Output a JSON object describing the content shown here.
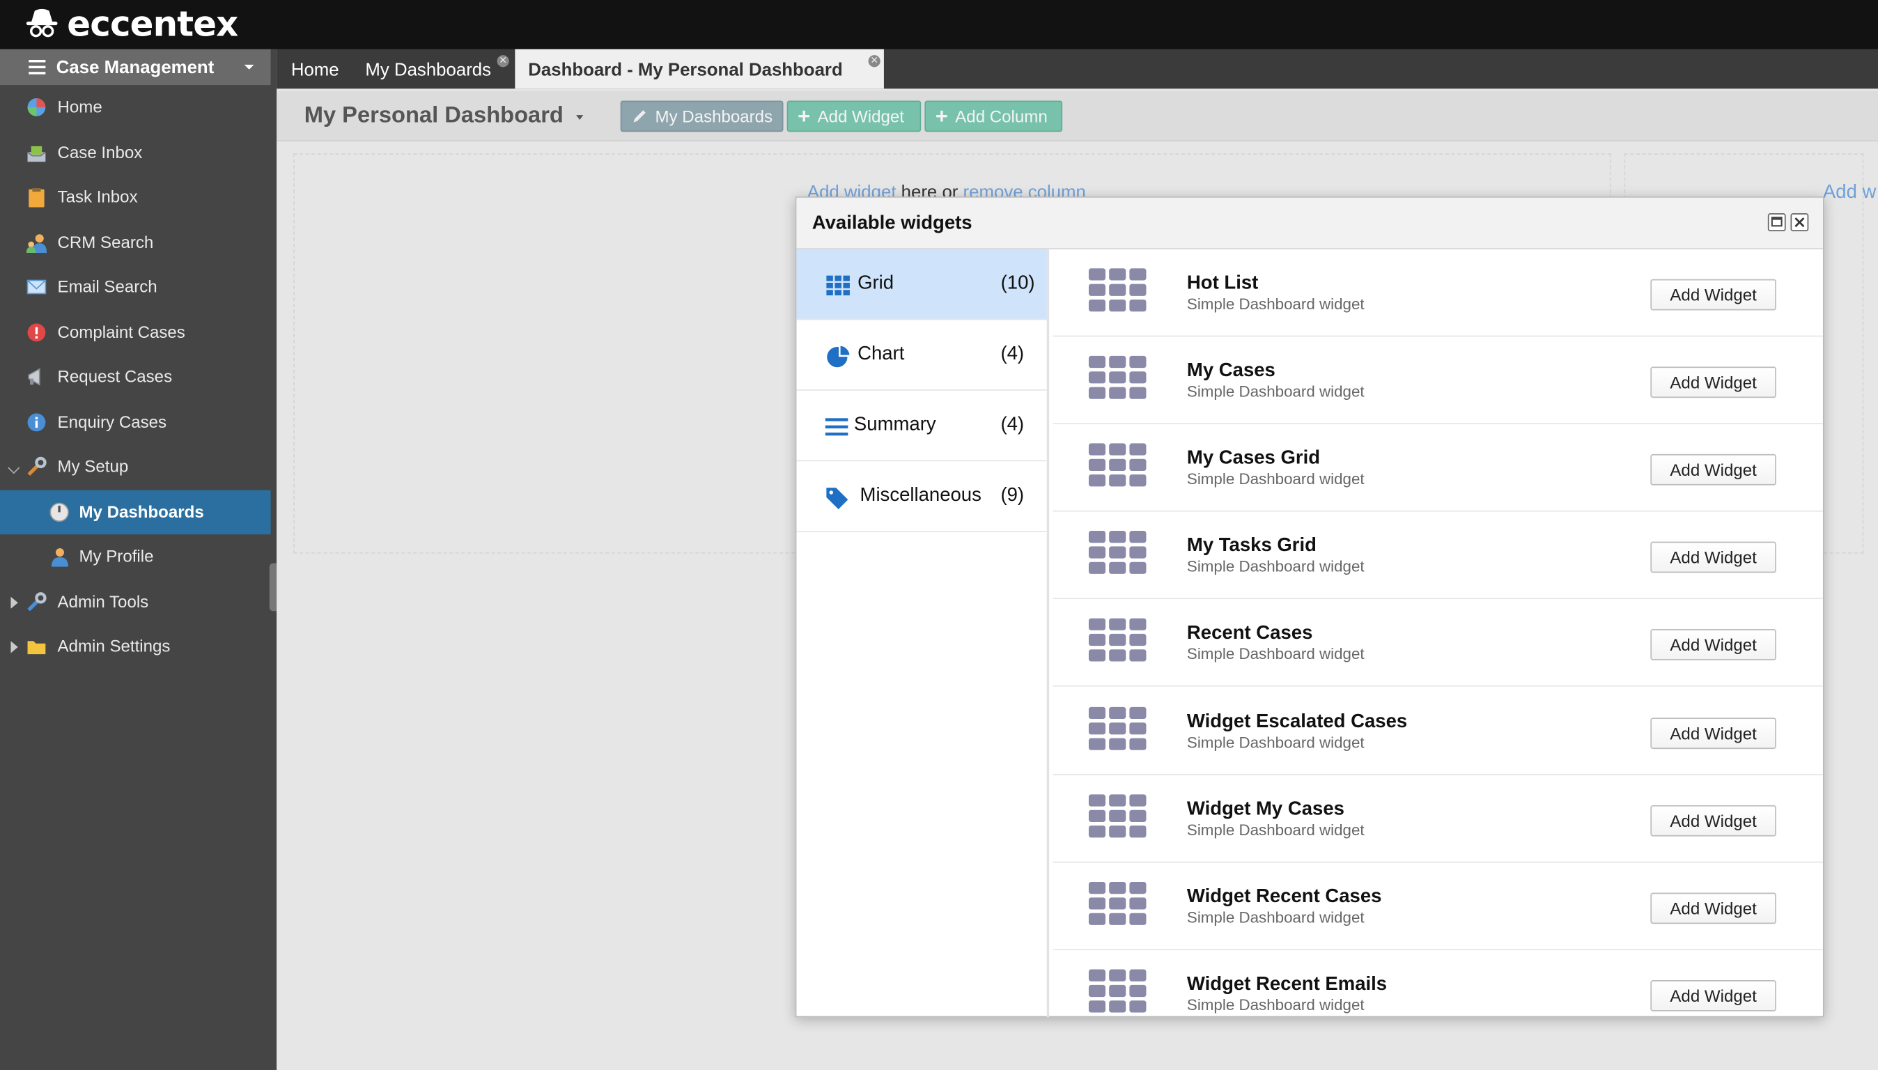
{
  "app": {
    "brand": "eccentex"
  },
  "sidebar": {
    "header": "Case Management",
    "items": [
      {
        "label": "Home",
        "icon": "home-globe-icon"
      },
      {
        "label": "Case Inbox",
        "icon": "case-inbox-icon"
      },
      {
        "label": "Task Inbox",
        "icon": "task-clipboard-icon"
      },
      {
        "label": "CRM Search",
        "icon": "crm-people-icon"
      },
      {
        "label": "Email Search",
        "icon": "envelope-icon"
      },
      {
        "label": "Complaint Cases",
        "icon": "alert-icon"
      },
      {
        "label": "Request Cases",
        "icon": "megaphone-icon"
      },
      {
        "label": "Enquiry Cases",
        "icon": "info-icon"
      },
      {
        "label": "My Setup",
        "icon": "wrench-icon"
      },
      {
        "label": "My Dashboards",
        "icon": "dashboard-gauge-icon"
      },
      {
        "label": "My Profile",
        "icon": "profile-user-icon"
      },
      {
        "label": "Admin Tools",
        "icon": "wrench-icon"
      },
      {
        "label": "Admin Settings",
        "icon": "folder-icon"
      }
    ]
  },
  "tabs": [
    {
      "label": "Home"
    },
    {
      "label": "My Dashboards"
    },
    {
      "label": "Dashboard - My Personal Dashboard"
    }
  ],
  "toolbar": {
    "title": "My Personal Dashboard",
    "my_dashboards": "My Dashboards",
    "add_widget": "Add Widget",
    "add_column": "Add Column"
  },
  "canvas": {
    "add_widget_link": "Add widget",
    "here_or": "here or",
    "remove_column_link": "remove column",
    "add_w_partial": "Add w"
  },
  "modal": {
    "title": "Available widgets",
    "categories": [
      {
        "name": "Grid",
        "count": "(10)"
      },
      {
        "name": "Chart",
        "count": "(4)"
      },
      {
        "name": "Summary",
        "count": "(4)"
      },
      {
        "name": "Miscellaneous",
        "count": "(9)"
      }
    ],
    "widgets": [
      {
        "name": "Hot List",
        "desc": "Simple Dashboard widget",
        "button": "Add Widget"
      },
      {
        "name": "My Cases",
        "desc": "Simple Dashboard widget",
        "button": "Add Widget"
      },
      {
        "name": "My Cases Grid",
        "desc": "Simple Dashboard widget",
        "button": "Add Widget"
      },
      {
        "name": "My Tasks Grid",
        "desc": "Simple Dashboard widget",
        "button": "Add Widget"
      },
      {
        "name": "Recent Cases",
        "desc": "Simple Dashboard widget",
        "button": "Add Widget"
      },
      {
        "name": "Widget Escalated Cases",
        "desc": "Simple Dashboard widget",
        "button": "Add Widget"
      },
      {
        "name": "Widget My Cases",
        "desc": "Simple Dashboard widget",
        "button": "Add Widget"
      },
      {
        "name": "Widget Recent Cases",
        "desc": "Simple Dashboard widget",
        "button": "Add Widget"
      },
      {
        "name": "Widget Recent Emails",
        "desc": "Simple Dashboard widget",
        "button": "Add Widget"
      }
    ]
  },
  "colors": {
    "accent_blue": "#2a6f9f",
    "grid_icon": "#8a8aa8",
    "selected_category": "#cfe3fb",
    "green_button": "#78c2ac"
  }
}
